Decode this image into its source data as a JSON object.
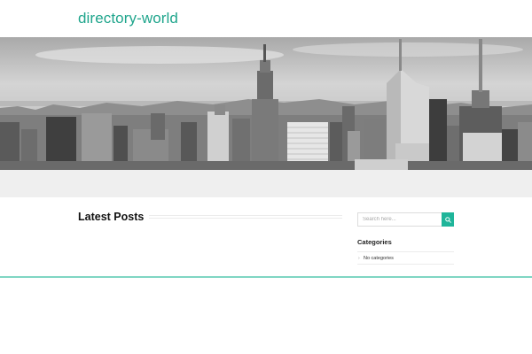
{
  "site": {
    "title": "directory-world",
    "accent_color": "#1fa58c"
  },
  "banner": {
    "image": "city-skyline-grayscale"
  },
  "main": {
    "section_title": "Latest Posts"
  },
  "sidebar": {
    "search": {
      "placeholder": "Search here...",
      "button_icon": "search-icon"
    },
    "categories": {
      "title": "Categories",
      "items": [
        {
          "bullet": "›",
          "label": "No categories"
        }
      ]
    }
  }
}
